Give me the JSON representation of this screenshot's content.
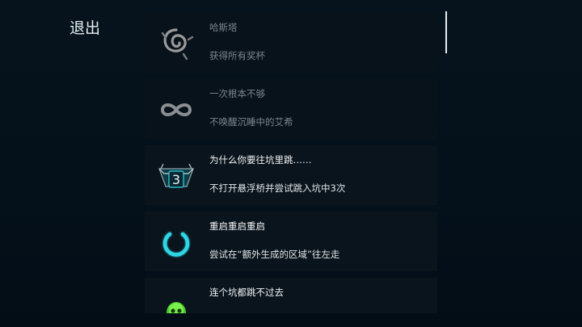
{
  "nav": {
    "exit_label": "退出"
  },
  "achievements": [
    {
      "title": "哈斯塔",
      "description": "获得所有奖杯",
      "icon": "spiral-sigil-icon",
      "locked": true
    },
    {
      "title": "一次根本不够",
      "description": "不唤醒沉睡中的艾希",
      "icon": "infinity-icon",
      "locked": true
    },
    {
      "title": "为什么你要往坑里跳……",
      "description": "不打开悬浮桥并尝试跳入坑中3次",
      "icon": "pit-three-icon",
      "icon_text": "3",
      "locked": false
    },
    {
      "title": "重启重启重启",
      "description": "尝试在“额外生成的区域”往左走",
      "icon": "power-icon",
      "locked": false
    },
    {
      "title": "连个坑都跳不过去",
      "description": "",
      "icon": "green-skull-icon",
      "locked": false
    }
  ],
  "colors": {
    "accent": "#2fd6e6",
    "background": "#061019",
    "card": "#0a141c",
    "skull": "#5fdc3c"
  }
}
